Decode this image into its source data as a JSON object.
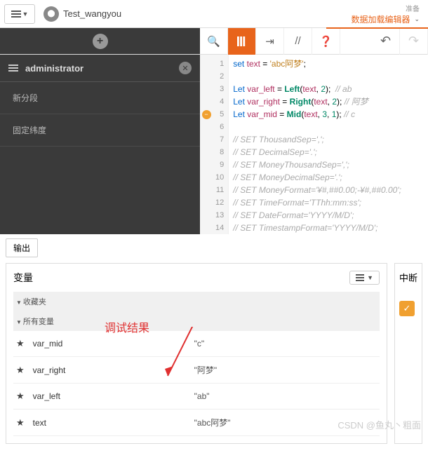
{
  "topbar": {
    "app_name": "Test_wangyou",
    "prep": "准备",
    "editor_label": "数据加载编辑器"
  },
  "sidebar": {
    "title": "administrator",
    "items": [
      "新分段",
      "固定纬度"
    ]
  },
  "code": {
    "lines": [
      {
        "n": 1,
        "t": "set",
        "raw": " text = 'abc阿梦';"
      },
      {
        "n": 2,
        "raw": ""
      },
      {
        "n": 3,
        "t": "Let",
        "v": "var_left",
        "eq": " = ",
        "fn": "Left",
        "args": "(text, 2);",
        "cm": "  // ab"
      },
      {
        "n": 4,
        "t": "Let",
        "v": "var_right",
        "eq": " = ",
        "fn": "Right",
        "args": "(text, 2);",
        "cm": " // 阿梦"
      },
      {
        "n": 5,
        "t": "Let",
        "v": "var_mid",
        "eq": " = ",
        "fn": "Mid",
        "args": "(text, 3, 1);",
        "cm": " // c",
        "marker": true
      },
      {
        "n": 6,
        "raw": ""
      },
      {
        "n": 7,
        "cm": "// SET ThousandSep=',';"
      },
      {
        "n": 8,
        "cm": "// SET DecimalSep='.';"
      },
      {
        "n": 9,
        "cm": "// SET MoneyThousandSep=',';"
      },
      {
        "n": 10,
        "cm": "// SET MoneyDecimalSep='.';"
      },
      {
        "n": 11,
        "cm": "// SET MoneyFormat='¥#,##0.00;-¥#,##0.00';"
      },
      {
        "n": 12,
        "cm": "// SET TimeFormat='TThh:mm:ss';"
      },
      {
        "n": 13,
        "cm": "// SET DateFormat='YYYY/M/D';"
      },
      {
        "n": 14,
        "cm": "// SET TimestampFormat='YYYY/M/D';"
      }
    ]
  },
  "output": {
    "tab": "输出",
    "var_title": "变量",
    "fav": "收藏夹",
    "all": "所有变量",
    "break": "中断",
    "annotation": "调试结果",
    "rows": [
      {
        "name": "var_mid",
        "val": "\"c\""
      },
      {
        "name": "var_right",
        "val": "\"阿梦\""
      },
      {
        "name": "var_left",
        "val": "\"ab\""
      },
      {
        "name": "text",
        "val": "\"abc阿梦\""
      }
    ]
  },
  "watermark": "CSDN @鱼丸丶粗面"
}
